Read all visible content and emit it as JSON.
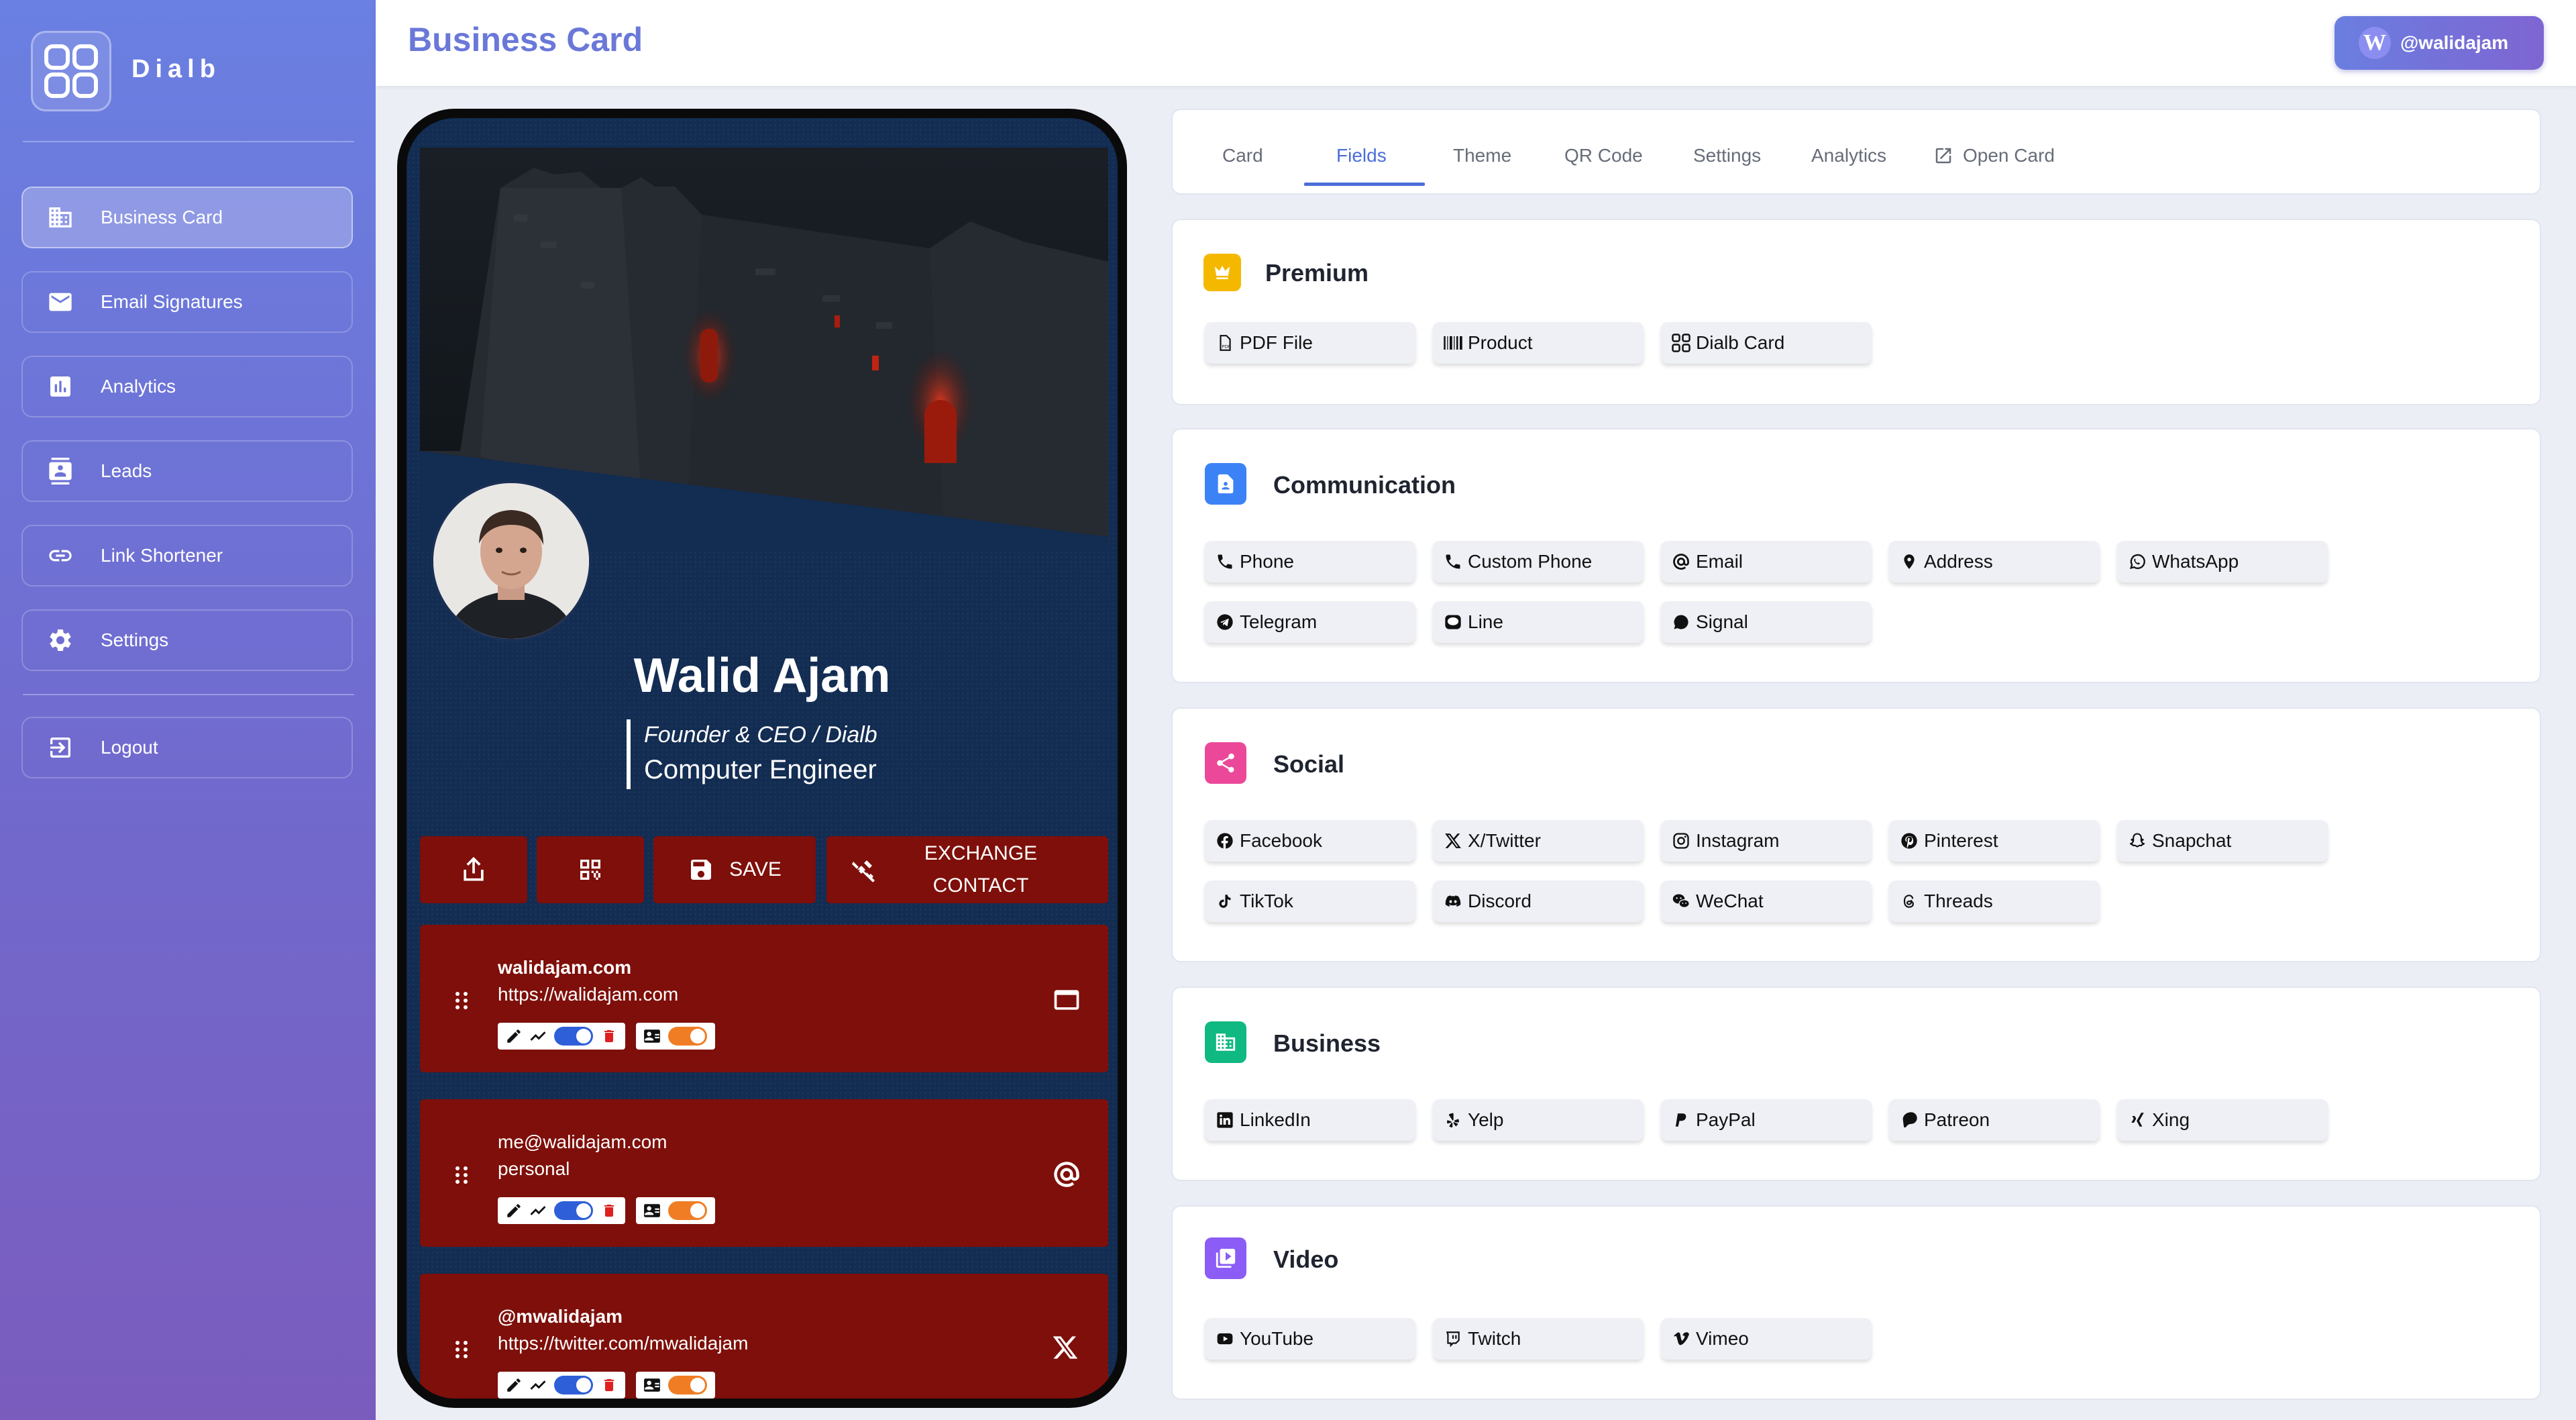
{
  "app": {
    "name": "Dialb"
  },
  "header": {
    "title": "Business Card",
    "user_initial": "W",
    "user_handle": "@walidajam"
  },
  "sidebar": {
    "items": [
      {
        "label": "Business Card",
        "icon": "building-icon",
        "active": true
      },
      {
        "label": "Email Signatures",
        "icon": "mail-icon"
      },
      {
        "label": "Analytics",
        "icon": "bar-chart-icon"
      },
      {
        "label": "Leads",
        "icon": "contacts-icon"
      },
      {
        "label": "Link Shortener",
        "icon": "link-icon"
      },
      {
        "label": "Settings",
        "icon": "gear-icon"
      }
    ],
    "logout": "Logout"
  },
  "card": {
    "name": "Walid Ajam",
    "job_title": "Founder & CEO / Dialb",
    "subtitle": "Computer Engineer",
    "actions": {
      "save": "SAVE",
      "exchange_line1": "EXCHANGE",
      "exchange_line2": "CONTACT"
    },
    "links": [
      {
        "title": "walidajam.com",
        "subtitle": "https://walidajam.com",
        "icon": "browser-icon"
      },
      {
        "title": "me@walidajam.com",
        "subtitle": "personal",
        "icon": "at-icon"
      },
      {
        "title": "@mwalidajam",
        "subtitle": "https://twitter.com/mwalidajam",
        "icon": "x-icon"
      }
    ],
    "colors": {
      "card_bg": "#122c52",
      "button": "#7e0f0a",
      "toggle_blue": "#2f5fd8",
      "toggle_orange": "#f07d24"
    }
  },
  "tabs": [
    "Card",
    "Fields",
    "Theme",
    "QR Code",
    "Settings",
    "Analytics",
    "Open Card"
  ],
  "active_tab": "Fields",
  "sections": {
    "premium": {
      "title": "Premium",
      "items": [
        "PDF File",
        "Product",
        "Dialb Card"
      ]
    },
    "communication": {
      "title": "Communication",
      "items": [
        "Phone",
        "Custom Phone",
        "Email",
        "Address",
        "WhatsApp",
        "Telegram",
        "Line",
        "Signal"
      ]
    },
    "social": {
      "title": "Social",
      "items": [
        "Facebook",
        "X/Twitter",
        "Instagram",
        "Pinterest",
        "Snapchat",
        "TikTok",
        "Discord",
        "WeChat",
        "Threads"
      ]
    },
    "business": {
      "title": "Business",
      "items": [
        "LinkedIn",
        "Yelp",
        "PayPal",
        "Patreon",
        "Xing"
      ]
    },
    "video": {
      "title": "Video",
      "items": [
        "YouTube",
        "Twitch",
        "Vimeo"
      ]
    }
  },
  "section_colors": {
    "premium": "#f5b800",
    "communication": "#3b82f6",
    "social": "#ec4899",
    "business": "#10b981",
    "video": "#8b5cf6"
  }
}
